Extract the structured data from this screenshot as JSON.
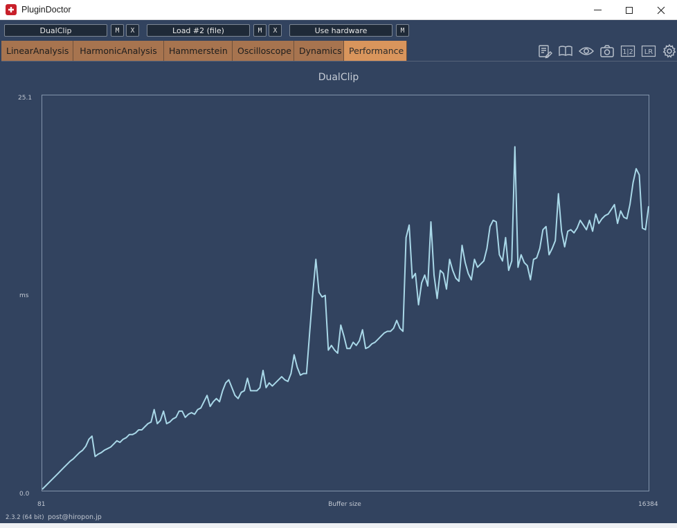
{
  "window": {
    "title": "PluginDoctor"
  },
  "toolbar": {
    "plugin1": "DualClip",
    "plugin2": "Load #2 (file)",
    "hardware": "Use hardware",
    "m_label": "M",
    "x_label": "X"
  },
  "tabs": [
    {
      "label": "LinearAnalysis"
    },
    {
      "label": "HarmonicAnalysis"
    },
    {
      "label": "Hammerstein"
    },
    {
      "label": "Oscilloscope"
    },
    {
      "label": "Dynamics"
    },
    {
      "label": "Performance",
      "active": true
    }
  ],
  "toolbar_icons": [
    "notes-icon",
    "book-icon",
    "eye-icon",
    "camera-icon",
    "compare-1-2-icon",
    "lr-icon",
    "settings-gear-icon"
  ],
  "icon_text": {
    "compare": "1|2",
    "lr": "LR"
  },
  "colors": {
    "background": "#32435f",
    "tab": "#a7744f",
    "tab_active": "#d9955c",
    "line": "#a9d8e8"
  },
  "footer": {
    "version": "2.3.2 (64 bit)",
    "email": "post@hiropon.jp"
  },
  "chart_data": {
    "type": "line",
    "title": "DualClip",
    "xlabel": "Buffer size",
    "ylabel": "ms",
    "x_tick_labels": [
      "81",
      "16384"
    ],
    "y_tick_labels": [
      "0.0",
      "25.1"
    ],
    "ylim": [
      0,
      25.1
    ],
    "grid": false,
    "series": [
      {
        "values": [
          0.0,
          0.2,
          0.4,
          0.6,
          0.8,
          1.0,
          1.2,
          1.4,
          1.6,
          1.8,
          1.95,
          2.15,
          2.35,
          2.5,
          2.75,
          3.2,
          3.4,
          2.1,
          2.25,
          2.35,
          2.5,
          2.6,
          2.7,
          2.9,
          3.1,
          3.0,
          3.2,
          3.3,
          3.5,
          3.5,
          3.6,
          3.8,
          3.8,
          4.0,
          4.2,
          4.3,
          5.1,
          4.2,
          4.4,
          5.0,
          4.2,
          4.3,
          4.5,
          4.6,
          5.0,
          5.0,
          4.6,
          4.8,
          4.9,
          4.8,
          5.1,
          5.2,
          5.6,
          6.0,
          5.3,
          5.6,
          5.8,
          5.6,
          6.3,
          6.8,
          7.0,
          6.5,
          6.0,
          5.8,
          6.2,
          6.3,
          7.1,
          6.3,
          6.3,
          6.3,
          6.5,
          7.6,
          6.5,
          6.8,
          6.6,
          6.8,
          7.0,
          7.2,
          7.0,
          6.9,
          7.4,
          8.6,
          7.8,
          7.3,
          7.4,
          7.4,
          10.0,
          12.5,
          14.7,
          12.6,
          12.3,
          12.4,
          8.9,
          9.2,
          8.9,
          8.7,
          10.5,
          9.8,
          9.0,
          9.0,
          9.4,
          9.2,
          9.5,
          10.2,
          9.0,
          9.1,
          9.3,
          9.4,
          9.6,
          9.8,
          10.0,
          10.1,
          10.1,
          10.3,
          10.8,
          10.3,
          10.1,
          16.1,
          16.9,
          13.5,
          13.8,
          11.8,
          13.2,
          13.7,
          13.0,
          17.1,
          13.7,
          12.2,
          14.0,
          13.8,
          12.8,
          14.7,
          14.0,
          13.5,
          13.3,
          15.6,
          14.5,
          13.8,
          13.4,
          14.7,
          14.2,
          14.4,
          14.6,
          15.4,
          16.8,
          17.2,
          17.1,
          15.0,
          14.6,
          16.1,
          14.0,
          14.6,
          21.9,
          14.2,
          15.0,
          14.5,
          14.3,
          13.4,
          14.7,
          14.8,
          15.4,
          16.6,
          16.8,
          15.0,
          15.4,
          15.9,
          18.9,
          16.5,
          15.5,
          16.5,
          16.6,
          16.4,
          16.7,
          17.2,
          16.9,
          16.6,
          17.2,
          16.5,
          17.6,
          17.0,
          17.3,
          17.5,
          17.6,
          17.9,
          18.2,
          17.0,
          17.8,
          17.4,
          17.3,
          18.2,
          19.6,
          20.5,
          20.1,
          16.7,
          16.6,
          18.1
        ]
      }
    ]
  }
}
